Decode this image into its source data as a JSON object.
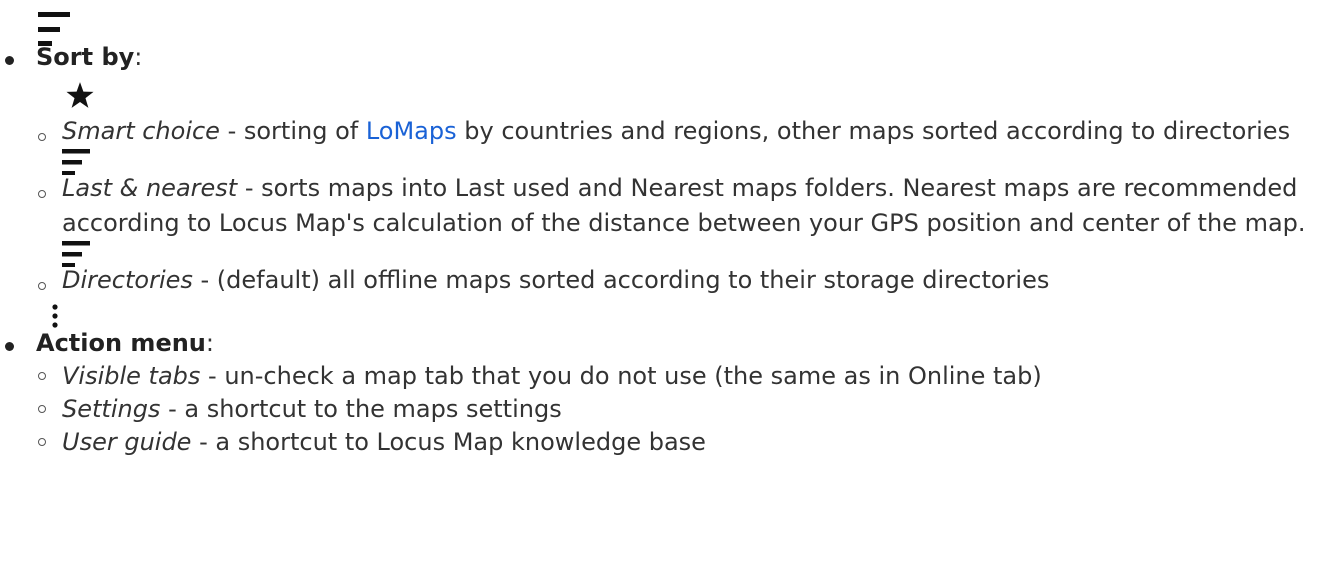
{
  "sort_section": {
    "icon": "sort-lines-icon",
    "label": "Sort by",
    "colon": ":",
    "items": [
      {
        "icon": "star-icon",
        "name": "Smart choice",
        "text_before_link": " - sorting of ",
        "link": "LoMaps",
        "text_after_link": " by countries and regions, other maps sorted according to directories"
      },
      {
        "icon": "sort-lines-icon",
        "name": "Last & nearest",
        "text": " - sorts maps into Last used and Nearest maps folders. Nearest maps are recommended according to Locus Map's calculation of the distance between your GPS position and center of the map."
      },
      {
        "icon": "sort-lines-icon",
        "name": "Directories",
        "text": " - (default) all offline maps sorted according to their storage directories"
      }
    ]
  },
  "action_section": {
    "icon": "more-vertical-icon",
    "label": "Action menu",
    "colon": ":",
    "items": [
      {
        "name": "Visible tabs",
        "text": " - un-check a map tab that you do not use (the same as in Online tab)"
      },
      {
        "name": "Settings",
        "text": " - a shortcut to the maps settings"
      },
      {
        "name": "User guide",
        "text": " - a shortcut to Locus Map knowledge base"
      }
    ]
  },
  "colors": {
    "text": "#333333",
    "link": "#1a62d6",
    "icon": "#111111"
  }
}
